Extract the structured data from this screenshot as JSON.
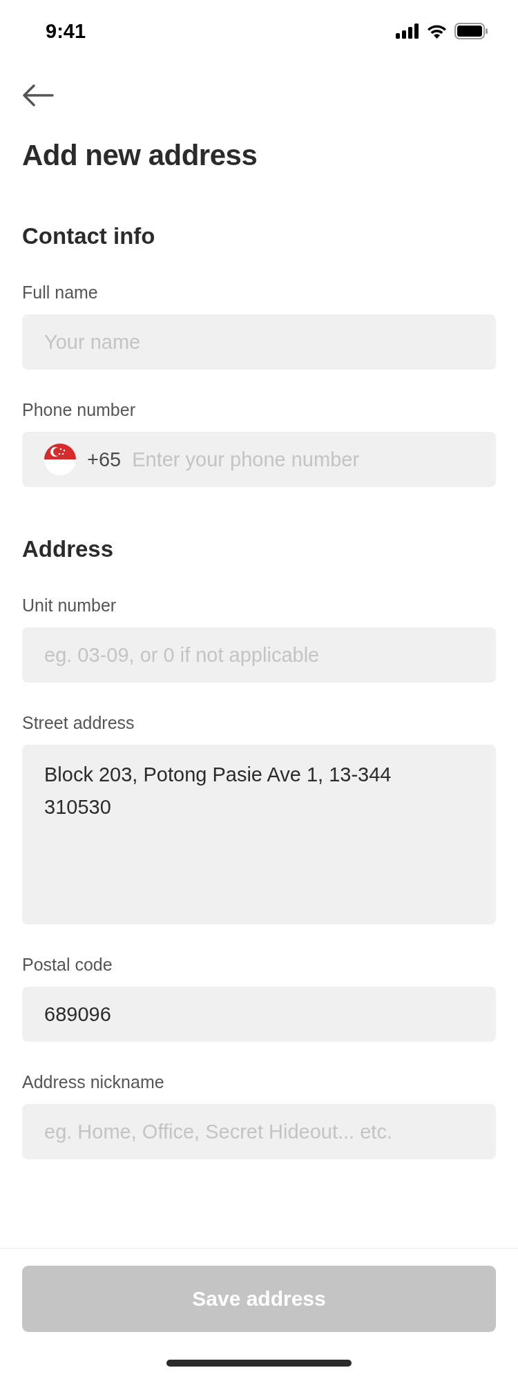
{
  "status_bar": {
    "time": "9:41"
  },
  "title": "Add new address",
  "sections": [
    {
      "title": "Contact info",
      "fields": [
        {
          "kind": "text",
          "label": "Full name",
          "placeholder": "Your name"
        },
        {
          "kind": "phone",
          "label": "Phone number",
          "country_code": "+65",
          "placeholder": "Enter your phone number"
        }
      ]
    },
    {
      "title": "Address",
      "fields": [
        {
          "kind": "text",
          "label": "Unit number",
          "placeholder": "eg. 03-09, or 0 if not applicable"
        },
        {
          "kind": "textarea",
          "label": "Street address",
          "value": "Block 203, Potong Pasie Ave 1, 13-344\n310530"
        },
        {
          "kind": "text",
          "label": "Postal code",
          "value": "689096"
        },
        {
          "kind": "text",
          "label": "Address nickname",
          "placeholder": "eg. Home, Office, Secret Hideout... etc."
        }
      ]
    }
  ],
  "save_button": {
    "label": "Save address",
    "disabled": true
  }
}
